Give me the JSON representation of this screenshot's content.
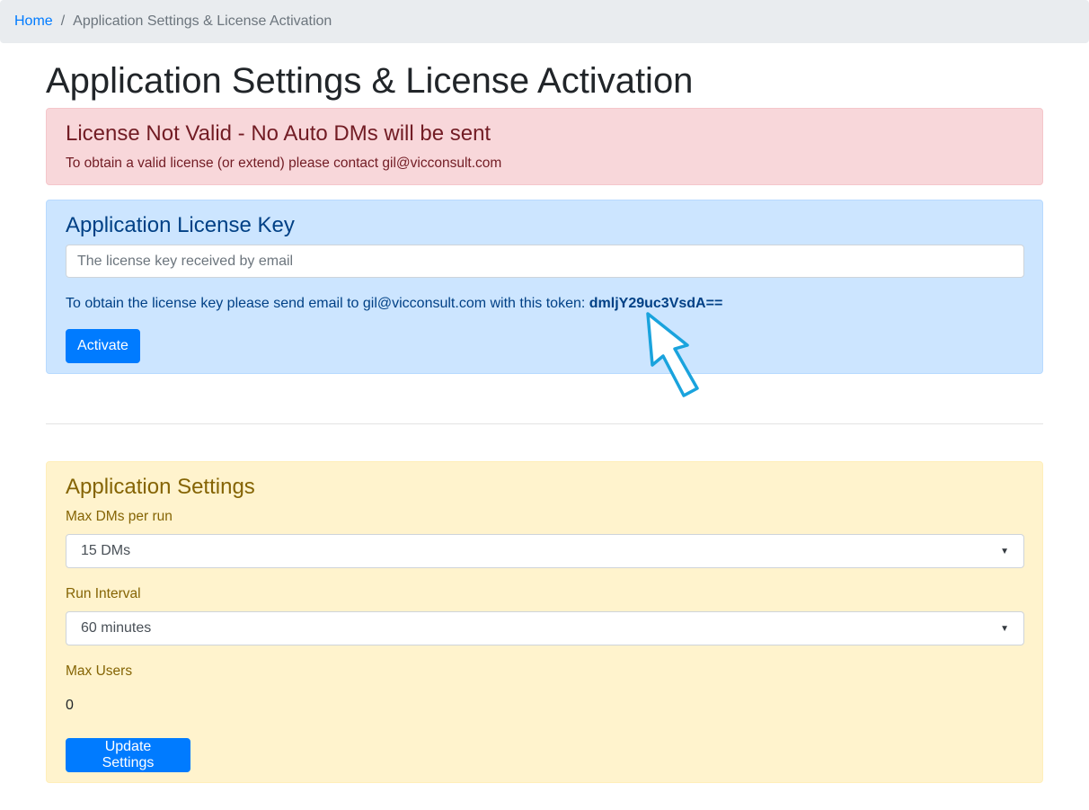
{
  "breadcrumb": {
    "home": "Home",
    "separator": "/",
    "current": "Application Settings & License Activation"
  },
  "page_title": "Application Settings & License Activation",
  "license_alert": {
    "title": "License Not Valid - No Auto DMs will be sent",
    "message": "To obtain a valid license (or extend) please contact gil@vicconsult.com"
  },
  "license_key": {
    "title": "Application License Key",
    "input_value": "",
    "input_placeholder": "The license key received by email",
    "token_text": "To obtain the license key please send email to gil@vicconsult.com with this token:",
    "token": "dmljY29uc3VsdA==",
    "activate_label": "Activate"
  },
  "settings": {
    "title": "Application Settings",
    "max_dms_label": "Max DMs per run",
    "max_dms_value": "15 DMs",
    "run_interval_label": "Run Interval",
    "run_interval_value": "60 minutes",
    "max_users_label": "Max Users",
    "max_users_value": "0",
    "update_label": "Update Settings"
  },
  "colors": {
    "primary": "#007bff",
    "danger_bg": "#f8d7da",
    "info_bg": "#cce5ff",
    "warning_bg": "#fff3cd",
    "annotation_arrow": "#1aa3dd"
  },
  "icons": {
    "select_caret": "chevron-down-icon",
    "annotation": "pointer-arrow-icon"
  }
}
